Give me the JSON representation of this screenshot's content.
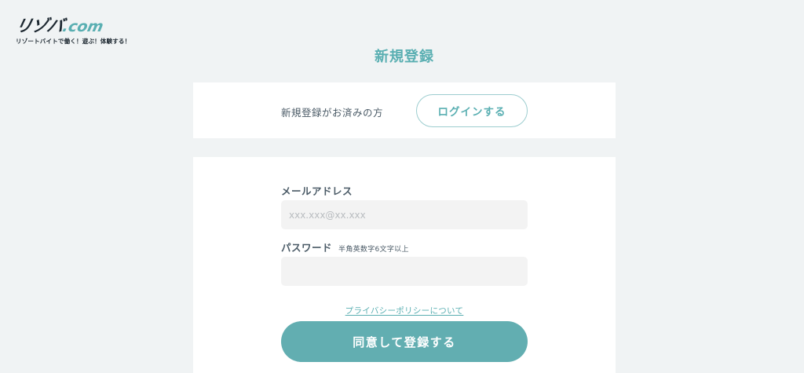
{
  "logo": {
    "main": "リゾバ",
    "suffix": ".com",
    "tagline": "リゾートバイトで働く！遊ぶ！体験する！"
  },
  "page": {
    "title": "新規登録"
  },
  "login_card": {
    "text": "新規登録がお済みの方",
    "button_label": "ログインする"
  },
  "register_form": {
    "email": {
      "label": "メールアドレス",
      "placeholder": "xxx.xxx@xx.xxx",
      "value": ""
    },
    "password": {
      "label": "パスワード",
      "hint": "半角英数字6文字以上",
      "value": ""
    },
    "privacy_link": "プライバシーポリシーについて",
    "submit_label": "同意して登録する"
  },
  "colors": {
    "accent": "#5aafb2",
    "button_bg": "#62aeb1",
    "page_bg": "#f0f3f4",
    "text": "#4a5a66"
  }
}
